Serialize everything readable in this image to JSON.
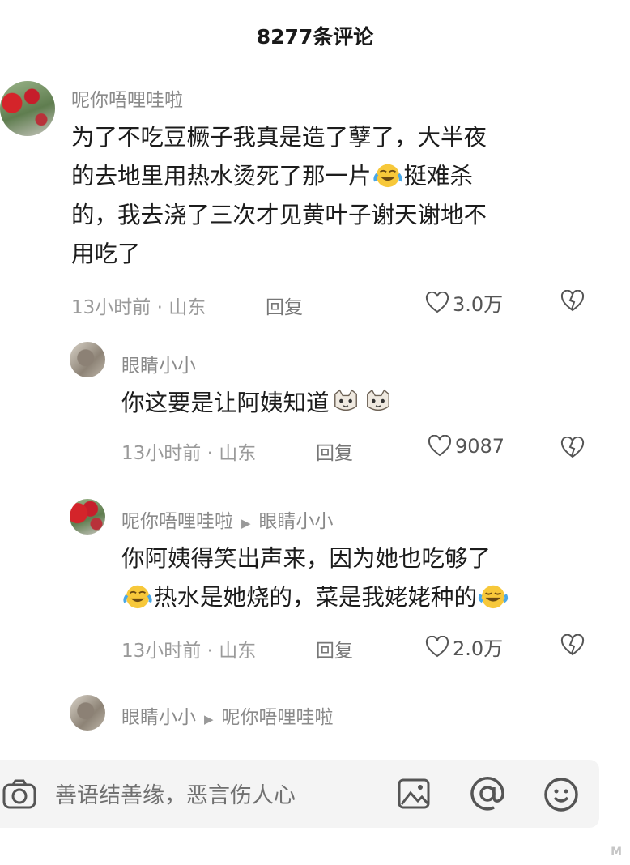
{
  "header": {
    "title": "8277条评论"
  },
  "comments": [
    {
      "username": "呢你唔哩哇啦",
      "lines": [
        "为了不吃豆橛子我真是造了孽了，大半夜",
        "的去地里用热水烫死了那一片",
        "挺难杀",
        "的，我去浇了三次才见黄叶子谢天谢地不",
        "用吃了"
      ],
      "time_location": "13小时前 · 山东",
      "reply_label": "回复",
      "likes": "3.0万"
    },
    {
      "username": "眼睛小小",
      "text": "你这要是让阿姨知道",
      "time_location": "13小时前 · 山东",
      "reply_label": "回复",
      "likes": "9087"
    },
    {
      "username": "呢你唔哩哇啦",
      "reply_to": "眼睛小小",
      "lines": [
        "你阿姨得笑出声来，因为她也吃够了",
        "热水是她烧的，菜是我姥姥种的"
      ],
      "time_location": "13小时前 · 山东",
      "reply_label": "回复",
      "likes": "2.0万"
    },
    {
      "username": "眼睛小小",
      "reply_to": "呢你唔哩哇啦"
    }
  ],
  "input": {
    "placeholder": "善语结善缘，恶言伤人心"
  },
  "icons": [
    "camera-icon",
    "image-icon",
    "at-icon",
    "emoji-icon",
    "heart-icon",
    "dislike-heart-icon"
  ],
  "watermark": "M"
}
